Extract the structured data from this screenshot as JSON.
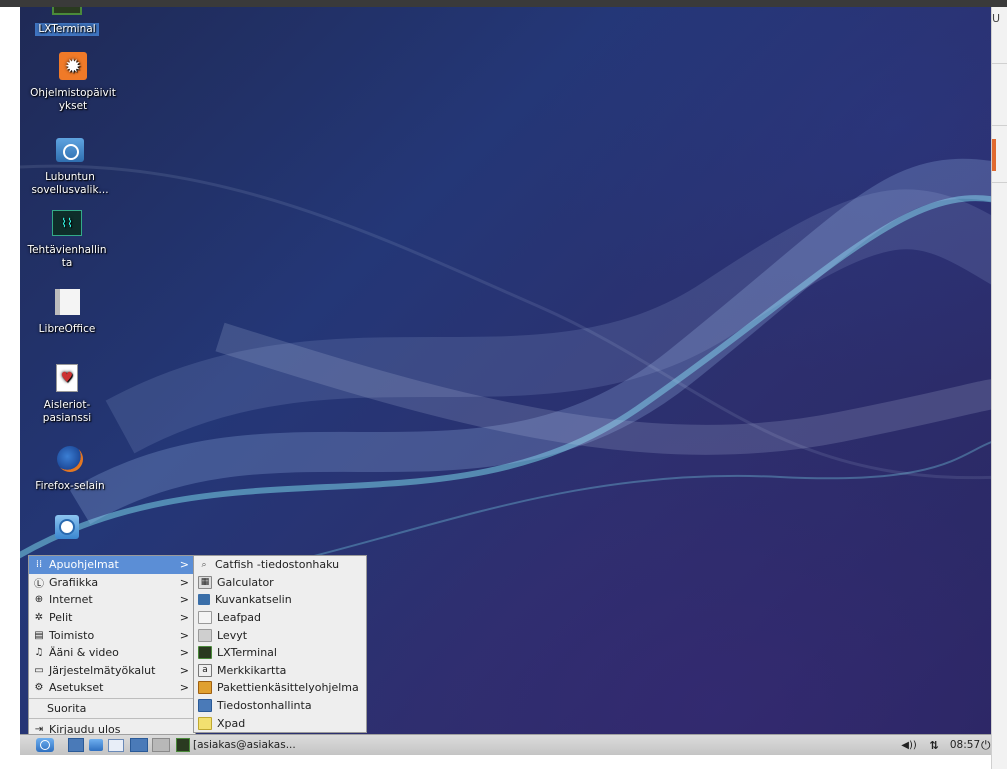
{
  "desktop_icons": [
    {
      "label": "LXTerminal",
      "icon": "terminal-icon",
      "selected": true
    },
    {
      "label": "Ohjelmistopäivitykset",
      "icon": "software-updater-icon"
    },
    {
      "label": "Lubuntun sovellusvalik...",
      "icon": "lubuntu-software-center-icon"
    },
    {
      "label": "Tehtävienhallinta",
      "icon": "task-manager-icon"
    },
    {
      "label": "LibreOffice",
      "icon": "libreoffice-icon"
    },
    {
      "label": "Aisleriot-pasianssi",
      "icon": "solitaire-icon"
    },
    {
      "label": "Firefox-selain",
      "icon": "firefox-icon"
    },
    {
      "label": "",
      "icon": "chromium-icon"
    }
  ],
  "menu": {
    "items": [
      {
        "label": "Apuohjelmat",
        "icon": "accessories-icon",
        "submenu": true,
        "active": true
      },
      {
        "label": "Grafiikka",
        "icon": "graphics-icon",
        "submenu": true
      },
      {
        "label": "Internet",
        "icon": "internet-icon",
        "submenu": true
      },
      {
        "label": "Pelit",
        "icon": "games-icon",
        "submenu": true
      },
      {
        "label": "Toimisto",
        "icon": "office-icon",
        "submenu": true
      },
      {
        "label": "Ääni & video",
        "icon": "sound-video-icon",
        "submenu": true
      },
      {
        "label": "Järjestelmätyökalut",
        "icon": "system-tools-icon",
        "submenu": true
      },
      {
        "label": "Asetukset",
        "icon": "settings-icon",
        "submenu": true
      }
    ],
    "run_label": "Suorita",
    "logout_label": "Kirjaudu ulos"
  },
  "submenu": {
    "items": [
      {
        "label": "Catfish -tiedostonhaku",
        "icon": "search-icon"
      },
      {
        "label": "Galculator",
        "icon": "calculator-icon"
      },
      {
        "label": "Kuvankatselin",
        "icon": "image-viewer-icon"
      },
      {
        "label": "Leafpad",
        "icon": "text-editor-icon"
      },
      {
        "label": "Levyt",
        "icon": "disks-icon"
      },
      {
        "label": "LXTerminal",
        "icon": "terminal-icon"
      },
      {
        "label": "Merkkikartta",
        "icon": "character-map-icon"
      },
      {
        "label": "Pakettienkäsittelyohjelma",
        "icon": "package-manager-icon"
      },
      {
        "label": "Tiedostonhallinta",
        "icon": "file-manager-icon"
      },
      {
        "label": "Xpad",
        "icon": "notes-icon"
      }
    ]
  },
  "taskbar": {
    "task_label": "[asiakas@asiakas...",
    "clock": "08:57"
  },
  "right_strip": {
    "text": "U"
  }
}
